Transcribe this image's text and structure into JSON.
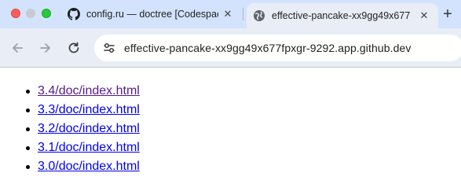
{
  "browser": {
    "tabs": [
      {
        "title": "config.ru — doctree [Codespaces",
        "icon": "github-icon",
        "active": false
      },
      {
        "title": "effective-pancake-xx9gg49x677",
        "icon": "globe-icon",
        "active": true
      }
    ],
    "new_tab_label": "+",
    "close_label": "✕",
    "url": "effective-pancake-xx9gg49x677fpxgr-9292.app.github.dev"
  },
  "page": {
    "links": [
      {
        "text": "3.4/doc/index.html",
        "visited": true
      },
      {
        "text": "3.3/doc/index.html",
        "visited": false
      },
      {
        "text": "3.2/doc/index.html",
        "visited": false
      },
      {
        "text": "3.1/doc/index.html",
        "visited": false
      },
      {
        "text": "3.0/doc/index.html",
        "visited": false
      }
    ]
  },
  "colors": {
    "tabstrip": "#d3e3fd",
    "toolbar": "#e9eef6",
    "link": "#0000ee",
    "visited_link": "#551a8b"
  }
}
